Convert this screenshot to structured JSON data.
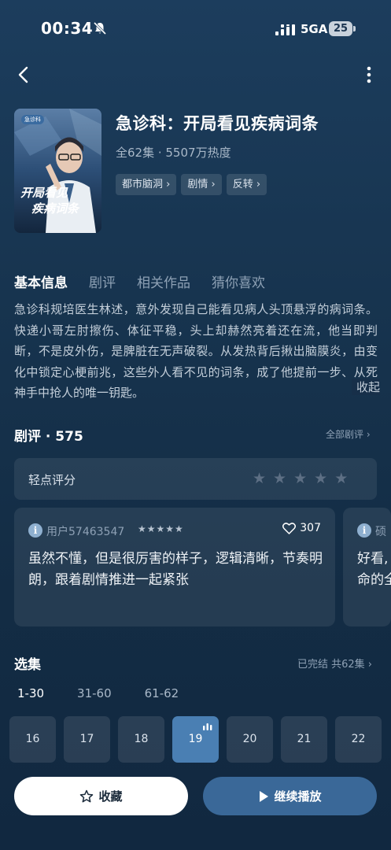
{
  "status_bar": {
    "time": "00:34",
    "network": "5GA",
    "battery": "25"
  },
  "drama": {
    "title": "急诊科：开局看见疾病词条",
    "meta": "全62集 · 5507万热度",
    "tags": [
      "都市脑洞 ›",
      "剧情 ›",
      "反转 ›"
    ],
    "poster_badge": "急诊科",
    "poster_title_line1": "开局看见",
    "poster_title_line2": "疾病词条"
  },
  "tabs": [
    "基本信息",
    "剧评",
    "相关作品",
    "猜你喜欢"
  ],
  "description": {
    "text": "急诊科规培医生林述，意外发现自己能看见病人头顶悬浮的病词条。快递小哥左肘擦伤、体征平稳，头上却赫然亮着还在流，他当即判断，不是皮外伤，是脾脏在无声破裂。从发热背后揪出脑膜炎，由变化中锁定心梗前兆，这些外人看不见的词条，成了他提前一步、从死神手中抢人的唯一钥匙。",
    "collapse_label": "收起"
  },
  "reviews": {
    "title": "剧评 · 575",
    "all_label": "全部剧评 ›",
    "rating_label": "轻点评分",
    "cards": [
      {
        "user": "用户57463547",
        "stars": "★★★★★",
        "likes": "307",
        "text": "虽然不懂，但是很厉害的样子，逻辑清晰，节奏明朗，跟着剧情推进一起紧张"
      },
      {
        "user": "硕",
        "text_line1": "好看,",
        "text_line2": "命的全"
      }
    ]
  },
  "episodes": {
    "title": "选集",
    "status": "已完结 共62集 ›",
    "ranges": [
      "1-30",
      "31-60",
      "61-62"
    ],
    "items": [
      "16",
      "17",
      "18",
      "19",
      "20",
      "21",
      "22"
    ],
    "current": "19"
  },
  "actions": {
    "favorite_label": "收藏",
    "play_label": "继续播放"
  },
  "colors": {
    "accent": "#4a7fb3",
    "play_button": "#3a6898",
    "background_top": "#1c3d5d"
  }
}
